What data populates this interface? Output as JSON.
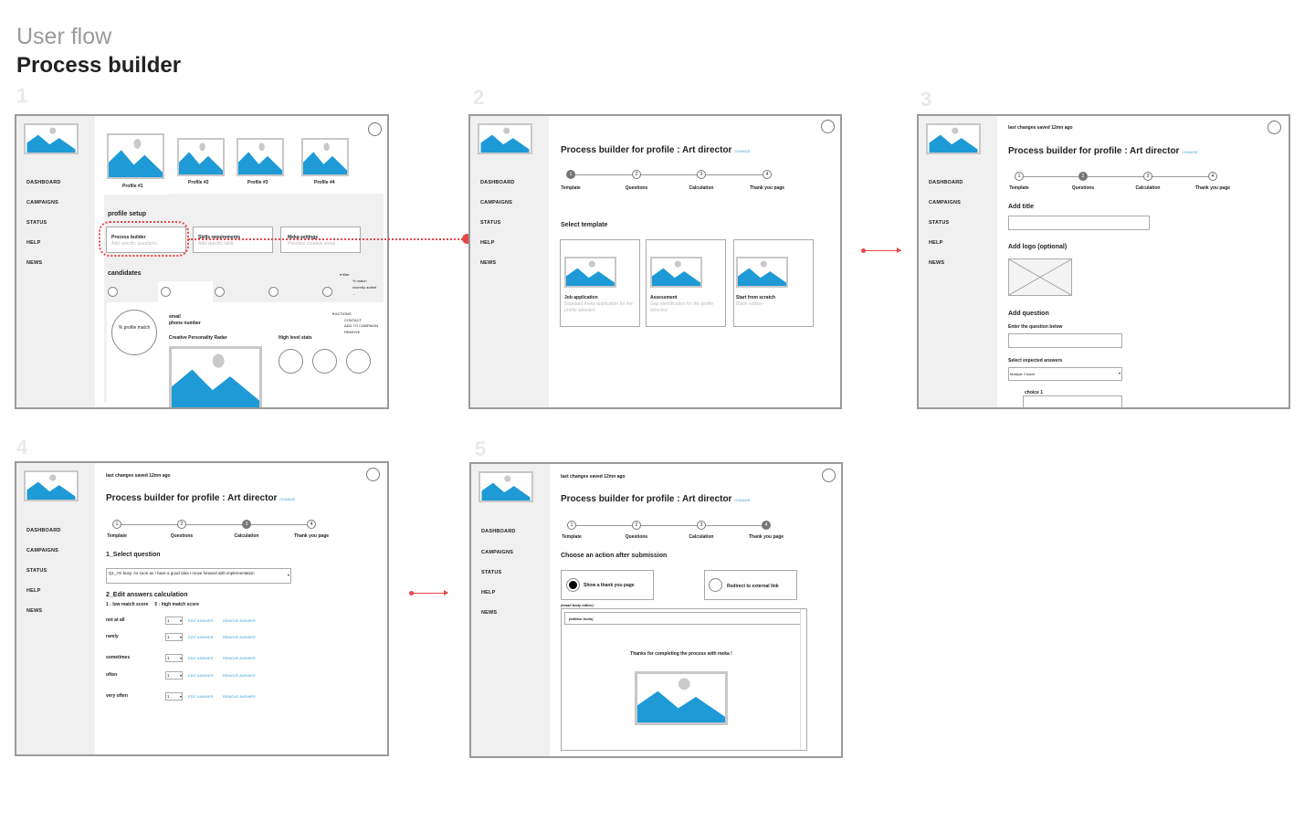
{
  "header": {
    "subtitle": "User flow",
    "title": "Process builder"
  },
  "step_numbers": [
    "1",
    "2",
    "3",
    "4",
    "5"
  ],
  "nav": [
    "DASHBOARD",
    "CAMPAIGNS",
    "STATUS",
    "HELP",
    "NEWS"
  ],
  "screen1": {
    "profiles": [
      "Profile #1",
      "Profile #2",
      "Profile #3",
      "Profile #4"
    ],
    "profile_setup": "profile setup",
    "boxes": [
      {
        "title": "Process builder",
        "sub": "Add specific questions"
      },
      {
        "title": "Skills requirements",
        "sub": "Add specific skills"
      },
      {
        "title": "Meka settings",
        "sub": "Prioritize creative areas"
      }
    ],
    "candidates": "candidates",
    "filter": {
      "title": "filter",
      "items": [
        "% match",
        "recently added",
        "..."
      ]
    },
    "match": "% profile match",
    "email": "email",
    "phone": "phone number",
    "radar": "Creative Personality Radar",
    "stats": "High level stats",
    "actions": {
      "title": "ACTIONS",
      "items": [
        "CONTACT",
        "ADD TO CAMPAIGN",
        "REMOVE"
      ]
    }
  },
  "builder": {
    "title": "Process builder for profile : Art director",
    "change": "CHANGE",
    "saved": "last changes saved 12mn ago",
    "steps": [
      "Template",
      "Questions",
      "Calculation",
      "Thank you page"
    ]
  },
  "screen2": {
    "select_template": "Select template",
    "templates": [
      {
        "title": "Job application",
        "sub": "Standard meka application for the profile selected"
      },
      {
        "title": "Assessment",
        "sub": "Gap identification for the profile selected"
      },
      {
        "title": "Start from scratch",
        "sub": "Blank edition"
      }
    ]
  },
  "screen3": {
    "add_title": "Add title",
    "add_logo": "Add logo (optional)",
    "add_question": "Add question",
    "enter_question": "Enter the question below",
    "select_answers": "Select expected answers",
    "answer_type": "Multiple Choice",
    "choice1": "choice 1"
  },
  "screen4": {
    "select_question": "1_Select question",
    "question_value": "Q1_I'm busy. As soon as I have a good idea I move forward with implementation",
    "edit_calc": "2_Edit answers calculation",
    "scale": "1 : low match score     5 : high match score",
    "answers": [
      "not at all",
      "rarely",
      "sometimes",
      "often",
      "very often"
    ],
    "score": "1",
    "edit": "EDIT ANSWER",
    "remove": "REMOVE ANSWER"
  },
  "screen5": {
    "choose": "Choose an action after submission",
    "option1": "Show a thank you page",
    "option2": "Redirect to external link",
    "email_editor": "(email body editor)",
    "edition_tools": "(edition tools)",
    "thanks": "Thanks for completing the process with meka !"
  },
  "colors": {
    "accent": "#1e9ad6",
    "connector": "#e8474a",
    "frame_border": "#9a9a9a",
    "sidebar": "#f0f0f0"
  }
}
